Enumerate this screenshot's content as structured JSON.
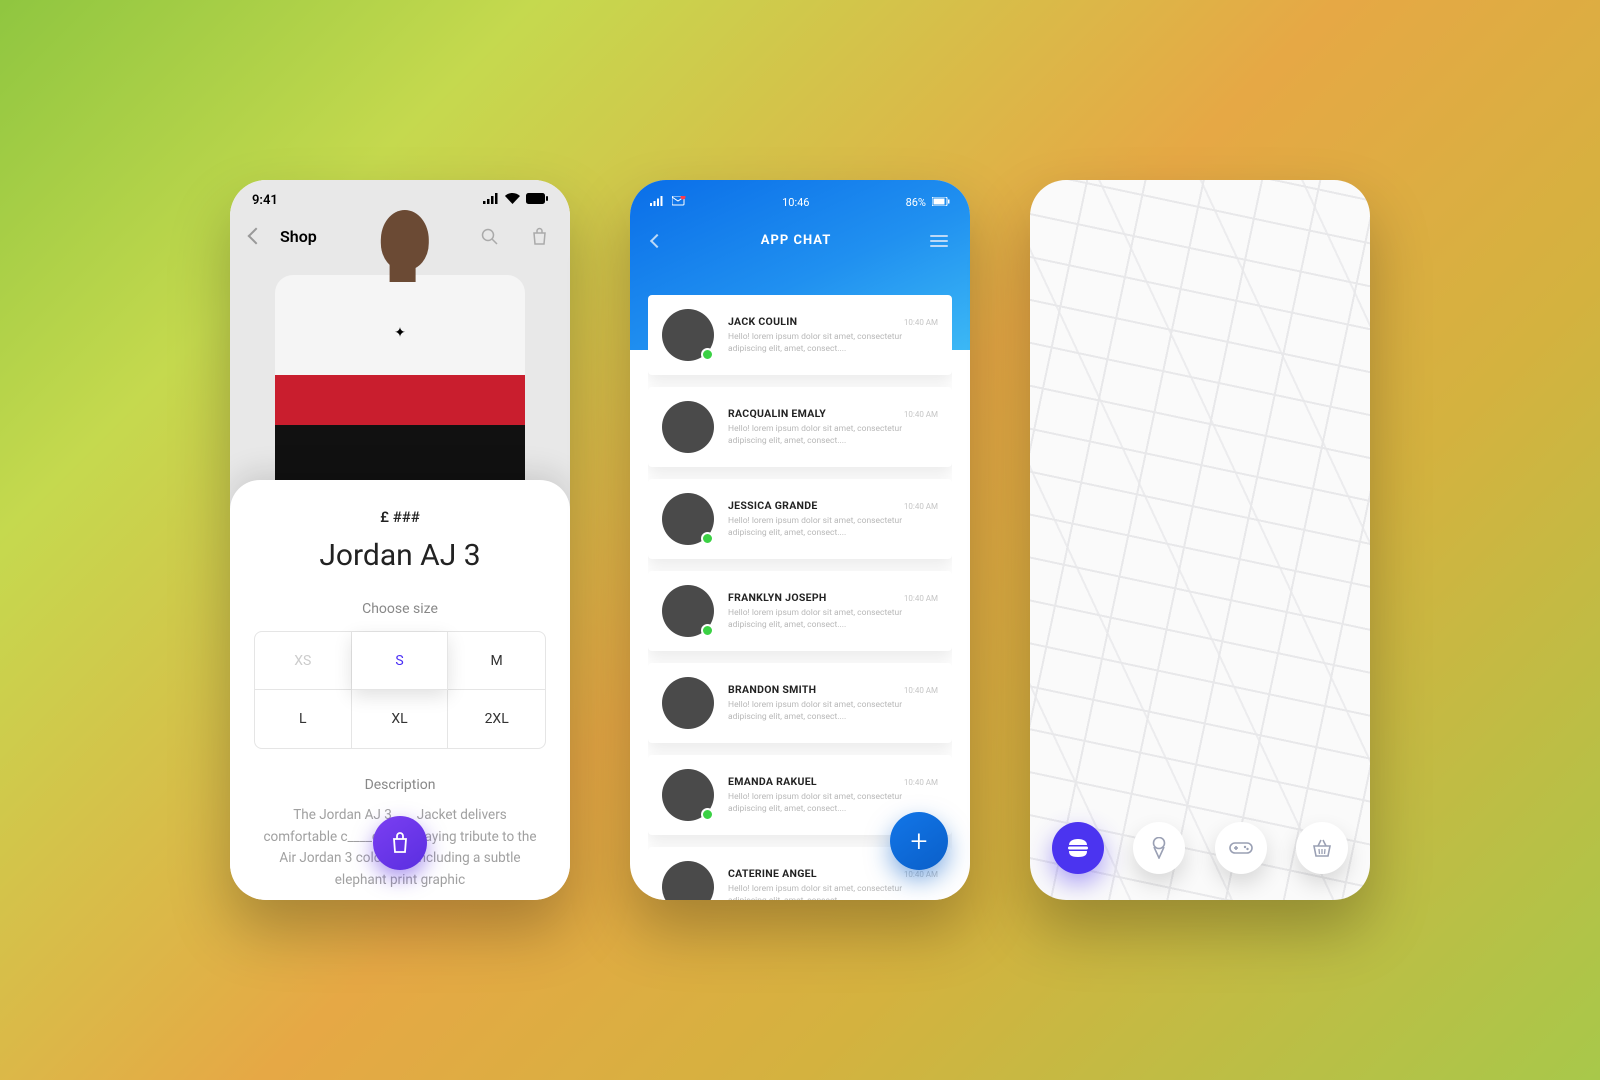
{
  "shop": {
    "time": "9:41",
    "header_title": "Shop",
    "price": "£ ###",
    "product_name": "Jordan AJ 3",
    "choose_label": "Choose size",
    "sizes": [
      "XS",
      "S",
      "M",
      "L",
      "XL",
      "2XL"
    ],
    "description_label": "Description",
    "description_text": "The Jordan AJ 3 ___ Jacket delivers comfortable c____e while paying tribute to the Air Jordan 3 colorway, including a subtle elephant print graphic"
  },
  "chat": {
    "time": "10:46",
    "battery": "86%",
    "title": "APP CHAT",
    "preview": "Hello! lorem ipsum dolor sit amet, consectetur adipiscing elit,  amet, consect....",
    "items": [
      {
        "name": "JACK COULIN",
        "time": "10:40 AM",
        "online": true
      },
      {
        "name": "RACQUALIN EMALY",
        "time": "10:40 AM",
        "online": false
      },
      {
        "name": "JESSICA GRANDE",
        "time": "10:40 AM",
        "online": true
      },
      {
        "name": "FRANKLYN JOSEPH",
        "time": "10:40 AM",
        "online": true
      },
      {
        "name": "BRANDON SMITH",
        "time": "10:40 AM",
        "online": false
      },
      {
        "name": "EMANDA RAKUEL",
        "time": "10:40 AM",
        "online": true
      },
      {
        "name": "CATERINE ANGEL",
        "time": "10:40 AM",
        "online": false
      }
    ]
  },
  "map": {
    "buttons": [
      "burger",
      "ice-cream",
      "game",
      "basket"
    ]
  }
}
